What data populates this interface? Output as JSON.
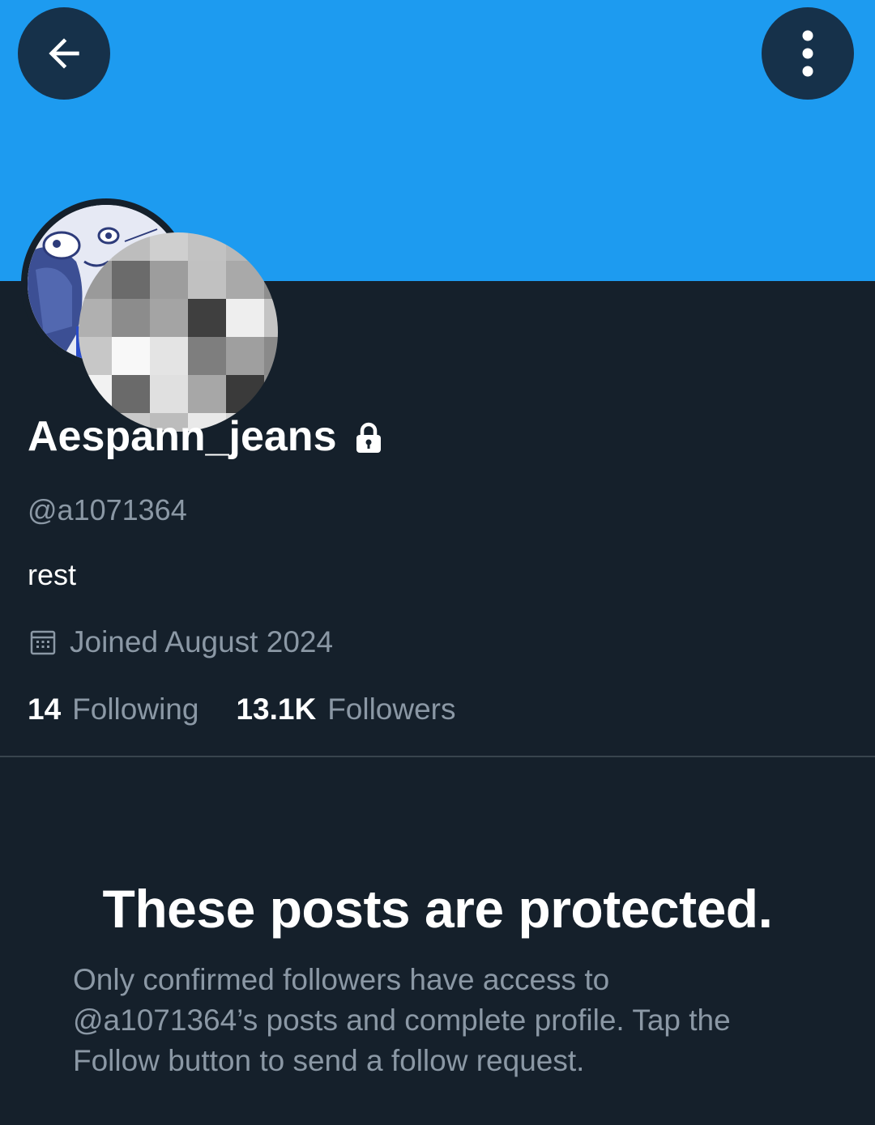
{
  "profile": {
    "display_name": "Aespann_jeans",
    "handle": "@a1071364",
    "bio": "rest",
    "joined": "Joined August 2024",
    "following_count": "14",
    "following_label": "Following",
    "followers_count": "13.1K",
    "followers_label": "Followers"
  },
  "protected_notice": {
    "title": "These posts are protected.",
    "description": "Only confirmed followers have access to @a1071364’s posts and complete profile. Tap the Follow button to send a follow request."
  },
  "icons": {
    "back": "arrow-left-icon",
    "more": "more-vertical-icon",
    "lock": "lock-icon",
    "calendar": "calendar-icon"
  },
  "colors": {
    "banner": "#1d9bf0",
    "background": "#15202b",
    "button_bg": "#16314a",
    "secondary_text": "#8b98a5",
    "divider": "#38444d"
  }
}
